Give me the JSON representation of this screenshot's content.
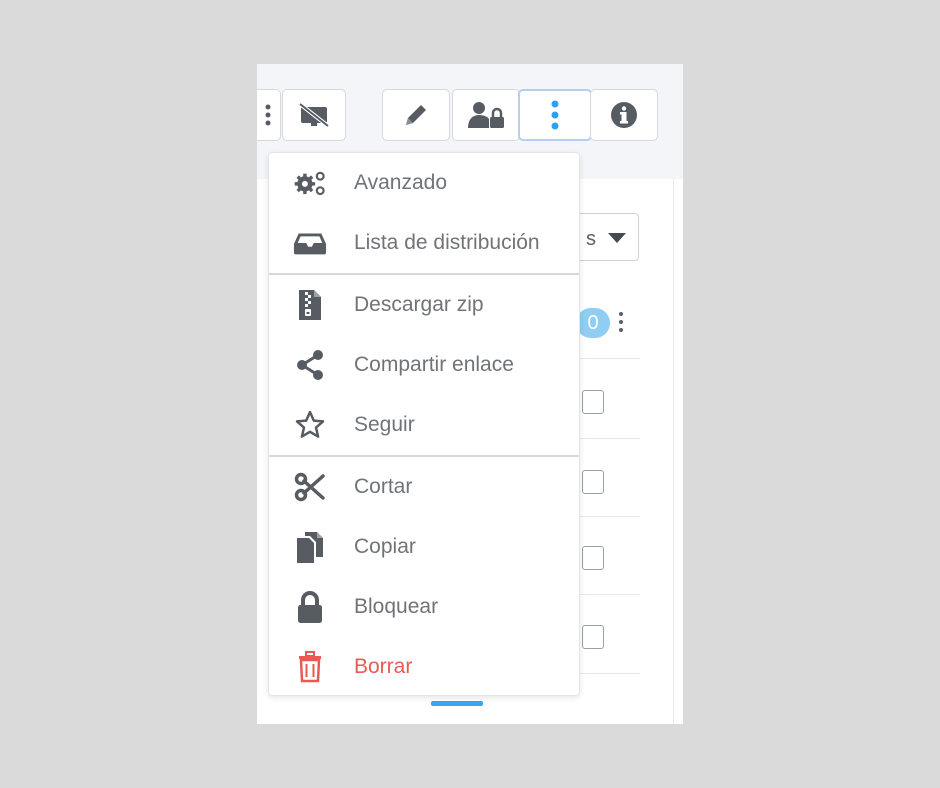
{
  "toolbar": {
    "buttons": [
      {
        "name": "more-actions",
        "icon": "vertical-ellipsis-icon"
      },
      {
        "name": "hide-preview",
        "icon": "no-preview-icon"
      },
      {
        "name": "edit",
        "icon": "pencil-icon"
      },
      {
        "name": "permissions",
        "icon": "user-lock-icon"
      },
      {
        "name": "menu",
        "icon": "vertical-ellipsis-icon",
        "active": true
      },
      {
        "name": "info",
        "icon": "info-circle-icon"
      }
    ]
  },
  "background": {
    "select_value": "s",
    "count_badge": "0"
  },
  "menu": {
    "items": [
      {
        "label": "Avanzado",
        "icon": "gears-icon"
      },
      {
        "label": "Lista de distribución",
        "icon": "inbox-icon"
      },
      {
        "label": "Descargar zip",
        "icon": "zip-file-icon"
      },
      {
        "label": "Compartir enlace",
        "icon": "share-icon"
      },
      {
        "label": "Seguir",
        "icon": "star-outline-icon"
      },
      {
        "label": "Cortar",
        "icon": "scissors-icon"
      },
      {
        "label": "Copiar",
        "icon": "copy-icon"
      },
      {
        "label": "Bloquear",
        "icon": "lock-icon"
      },
      {
        "label": "Borrar",
        "icon": "trash-icon"
      }
    ]
  },
  "colors": {
    "icon": "#565c62",
    "accent": "#2fa0ee",
    "danger": "#ea5a52",
    "text": "#6f7478"
  }
}
